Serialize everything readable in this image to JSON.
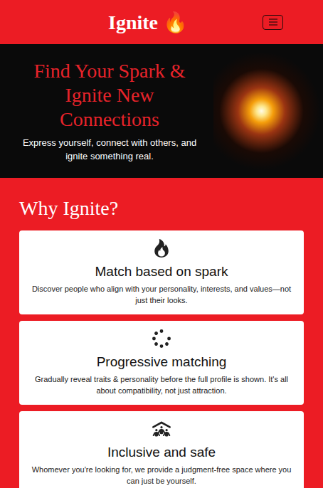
{
  "header": {
    "title": "Ignite 🔥"
  },
  "hero": {
    "heading": "Find Your Spark & Ignite New Connections",
    "subtitle": "Express yourself, connect with others, and ignite something real."
  },
  "section": {
    "title": "Why Ignite?",
    "features": [
      {
        "title": "Match based on spark",
        "description": "Discover people who align with your personality, interests, and values—not just their looks."
      },
      {
        "title": "Progressive matching",
        "description": "Gradually reveal traits & personality before the full profile is shown. It's all about compatibility, not just attraction."
      },
      {
        "title": "Inclusive and safe",
        "description": "Whomever you're looking for, we provide a judgment-free space where you can just be yourself."
      }
    ]
  }
}
